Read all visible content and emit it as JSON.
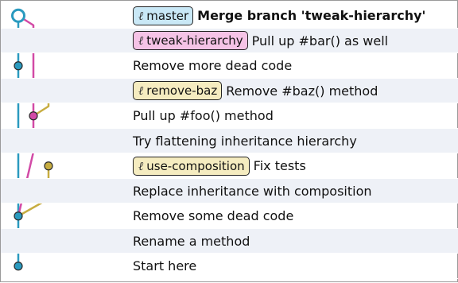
{
  "colors": {
    "main": "#2a9abf",
    "tweak": "#d24aa6",
    "baz": "#c7ad41",
    "composition": "#c7ad41",
    "row_alt": "#eef1f7"
  },
  "commits": [
    {
      "message": "Merge branch 'tweak-hierarchy'",
      "bold": true,
      "ref": {
        "label": "master",
        "icon": "branch-icon",
        "bg": "#c9e8f6"
      }
    },
    {
      "message": "Pull up #bar() as well",
      "bold": false,
      "ref": {
        "label": "tweak-hierarchy",
        "icon": "branch-icon",
        "bg": "#f5c3e6"
      }
    },
    {
      "message": "Remove more dead code",
      "bold": false,
      "ref": null
    },
    {
      "message": "Remove #baz() method",
      "bold": false,
      "ref": {
        "label": "remove-baz",
        "icon": "branch-icon",
        "bg": "#f5ecc0"
      }
    },
    {
      "message": "Pull up #foo() method",
      "bold": false,
      "ref": null
    },
    {
      "message": "Try flattening inheritance hierarchy",
      "bold": false,
      "ref": null
    },
    {
      "message": "Fix tests",
      "bold": false,
      "ref": {
        "label": "use-composition",
        "icon": "branch-icon",
        "bg": "#f5ecc0"
      }
    },
    {
      "message": "Replace inheritance with composition",
      "bold": false,
      "ref": null
    },
    {
      "message": "Remove some dead code",
      "bold": false,
      "ref": null
    },
    {
      "message": "Rename a method",
      "bold": false,
      "ref": null
    },
    {
      "message": "Start here",
      "bold": false,
      "ref": null
    }
  ]
}
